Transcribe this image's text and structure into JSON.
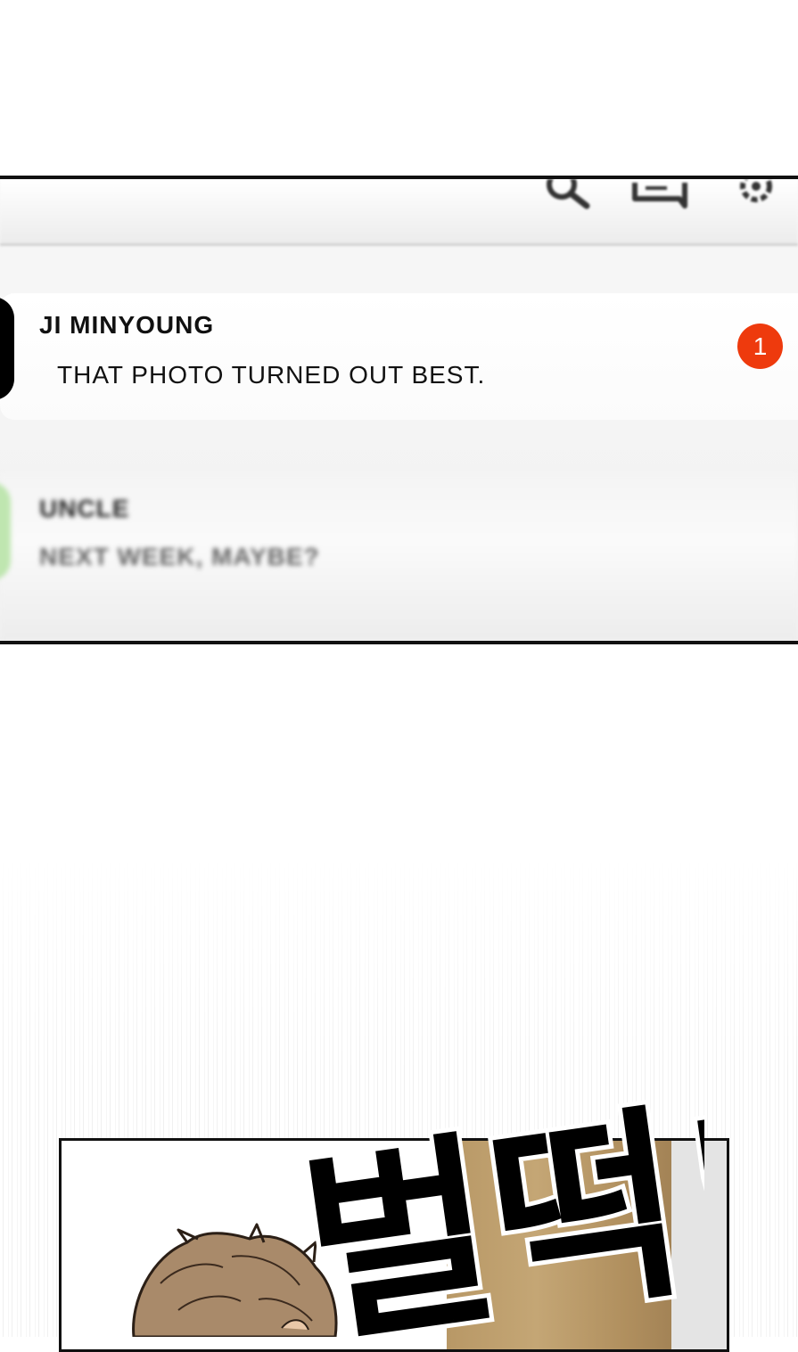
{
  "phone_screen": {
    "header_icons": [
      "search-icon",
      "chat-bubble-icon",
      "gear-icon"
    ],
    "chats": [
      {
        "name": "JI MINYOUNG",
        "preview": "THAT PHOTO TURNED OUT BEST.",
        "unread": "1",
        "avatar_color": "#000000"
      },
      {
        "name": "UNCLE",
        "preview": "NEXT WEEK, MAYBE?",
        "avatar_color": "#bfe6b0"
      }
    ],
    "badge_color": "#ee3a0d"
  },
  "comic_panel": {
    "sound_effect": "벌떡!",
    "background_color": "#c4a675"
  }
}
